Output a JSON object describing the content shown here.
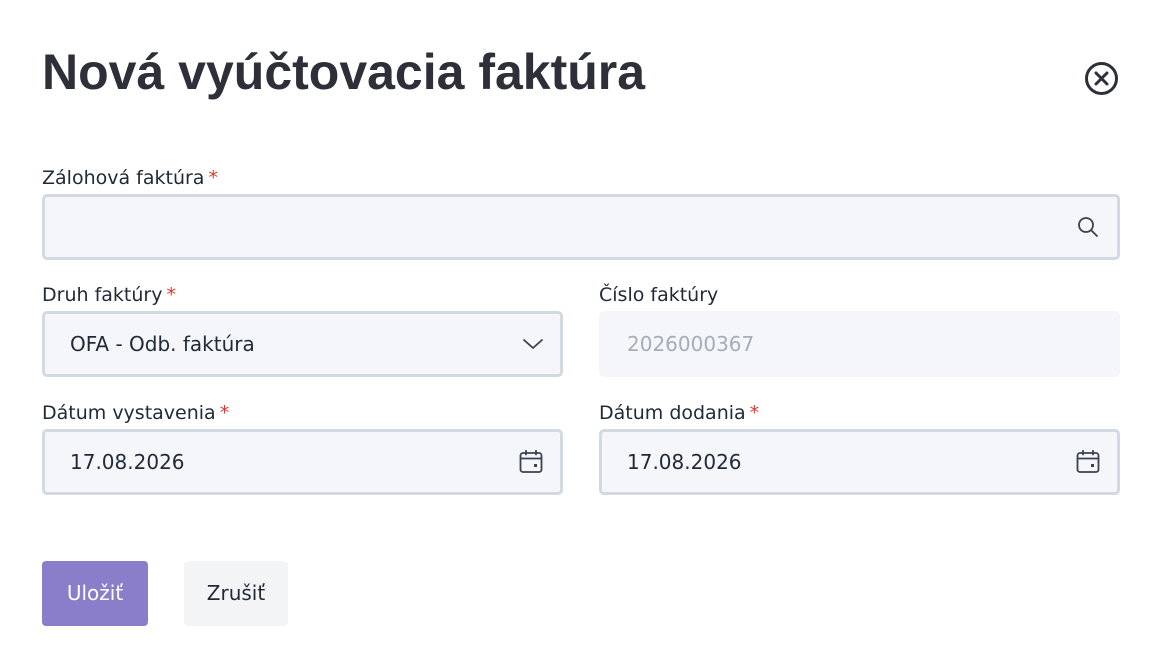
{
  "dialog": {
    "title": "Nová vyúčtovacia faktúra",
    "close_icon": "close-circle-icon"
  },
  "fields": {
    "advance_invoice": {
      "label": "Zálohová faktúra",
      "required_mark": "*",
      "value": "",
      "icon": "search-icon"
    },
    "invoice_type": {
      "label": "Druh faktúry",
      "required_mark": "*",
      "value": "OFA - Odb. faktúra",
      "icon": "chevron-down-icon"
    },
    "invoice_number": {
      "label": "Číslo faktúry",
      "value": "2026000367",
      "disabled": true
    },
    "issue_date": {
      "label": "Dátum vystavenia",
      "required_mark": "*",
      "value": "17.08.2026",
      "icon": "calendar-icon"
    },
    "delivery_date": {
      "label": "Dátum dodania",
      "required_mark": "*",
      "value": "17.08.2026",
      "icon": "calendar-icon"
    }
  },
  "actions": {
    "save_label": "Uložiť",
    "cancel_label": "Zrušiť"
  },
  "colors": {
    "primary": "#8a7dc9",
    "required": "#dc3b2f",
    "field_bg": "#f4f6f9",
    "field_border": "#d3d9e1"
  }
}
